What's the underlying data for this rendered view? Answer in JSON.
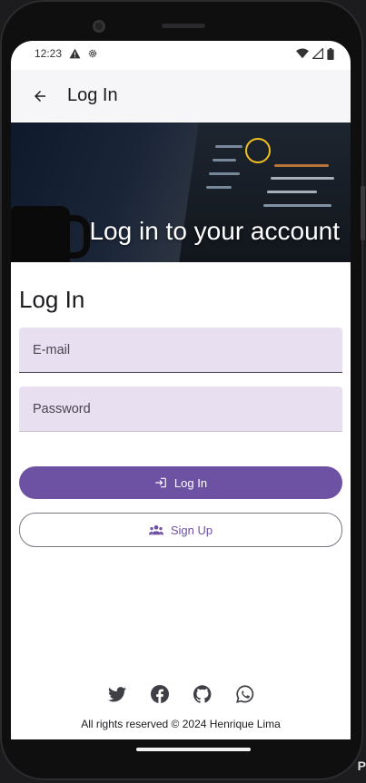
{
  "status_bar": {
    "time": "12:23",
    "left_icons": [
      "warning-icon",
      "settings-gear-icon"
    ],
    "right_icons": [
      "wifi-icon",
      "cellular-icon",
      "battery-icon"
    ]
  },
  "app_bar": {
    "back_icon": "arrow-left-icon",
    "title": "Log In"
  },
  "hero": {
    "headline": "Log in to your account"
  },
  "form": {
    "title": "Log In",
    "email_placeholder": "E-mail",
    "password_placeholder": "Password",
    "login_button_label": "Log In",
    "login_icon": "login-icon",
    "signup_button_label": "Sign Up",
    "signup_icon": "group-icon"
  },
  "social_links": [
    "twitter-icon",
    "facebook-icon",
    "github-icon",
    "whatsapp-icon"
  ],
  "footer": {
    "text": "All rights reserved © 2024 Henrique Lima"
  },
  "colors": {
    "primary": "#6d52a3",
    "field_background": "#e8dff0",
    "app_bar_background": "#f6f5f7"
  }
}
